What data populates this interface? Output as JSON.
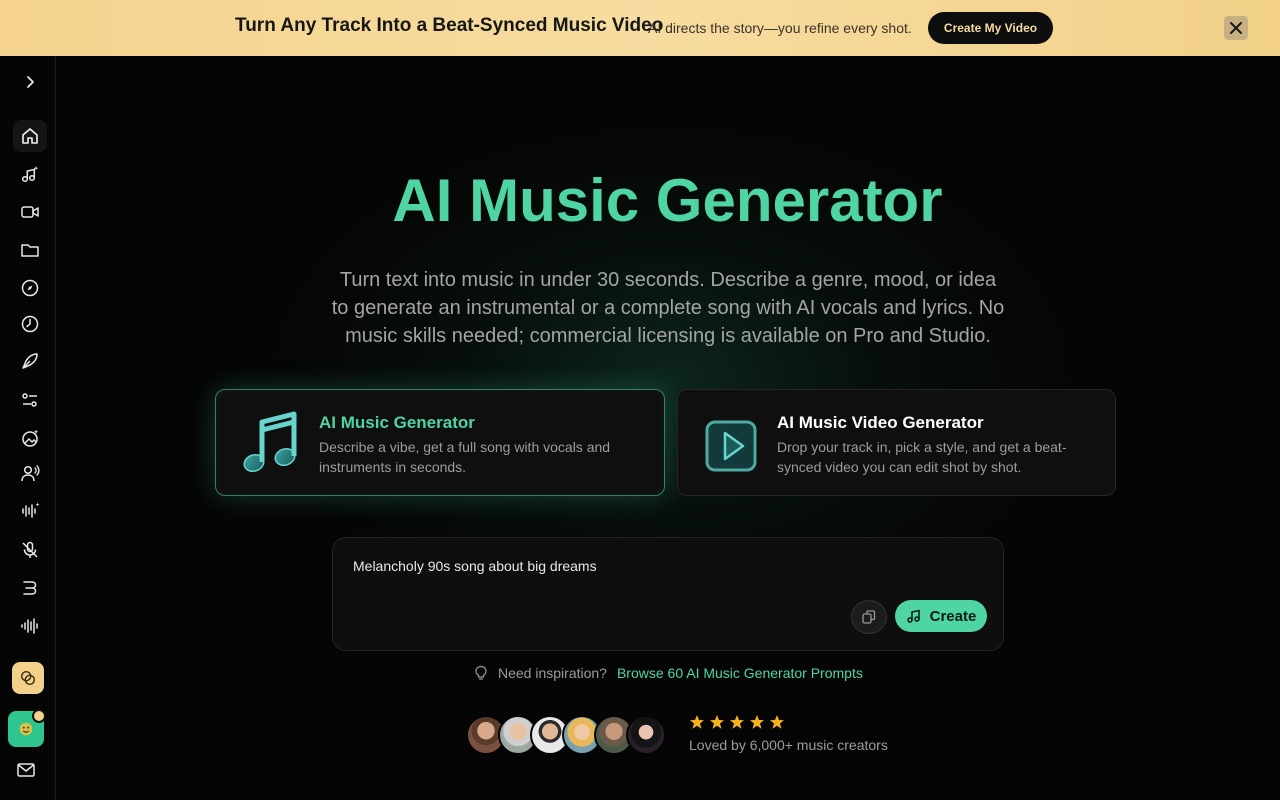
{
  "banner": {
    "title": "Turn Any Track Into a Beat-Synced Music Video",
    "subtitle": "AI directs the story—you refine every shot.",
    "cta": "Create My Video",
    "close_icon": "close-icon"
  },
  "sidebar": {
    "items": [
      {
        "name": "expand",
        "icon": "chevron-right-icon"
      },
      {
        "name": "home",
        "icon": "home-icon",
        "active": true
      },
      {
        "name": "music-generate",
        "icon": "music-sparkle-icon"
      },
      {
        "name": "video",
        "icon": "video-camera-icon"
      },
      {
        "name": "library",
        "icon": "folder-icon"
      },
      {
        "name": "explore",
        "icon": "compass-icon"
      },
      {
        "name": "history",
        "icon": "clock-icon"
      },
      {
        "name": "lyrics",
        "icon": "pen-icon"
      },
      {
        "name": "settings",
        "icon": "sliders-icon"
      },
      {
        "name": "image-gen",
        "icon": "image-sparkle-icon"
      },
      {
        "name": "voice",
        "icon": "person-voice-icon"
      },
      {
        "name": "audio-sparkle",
        "icon": "waveform-sparkle-icon"
      },
      {
        "name": "mute",
        "icon": "mic-off-icon"
      },
      {
        "name": "remix",
        "icon": "remix-icon"
      },
      {
        "name": "waveform",
        "icon": "waveform-icon"
      }
    ],
    "bottom": [
      "coin-icon",
      "user-avatar",
      "mail-icon"
    ]
  },
  "hero": {
    "title": "AI Music Generator",
    "description": "Turn text into music in under 30 seconds. Describe a genre, mood, or idea to generate an instrumental or a complete song with AI vocals and lyrics. No music skills needed; commercial licensing is available on Pro and Studio."
  },
  "cards": [
    {
      "title": "AI Music Generator",
      "description": "Describe a vibe, get a full song with vocals and instruments in seconds.",
      "icon": "music-note-icon",
      "active": true
    },
    {
      "title": "AI Music Video Generator",
      "description": "Drop your track in, pick a style, and get a beat-synced video you can edit shot by shot.",
      "icon": "play-video-icon",
      "active": false
    }
  ],
  "prompt": {
    "value": "Melancholy 90s song about big dreams",
    "create_label": "Create"
  },
  "inspiration": {
    "question": "Need inspiration?",
    "link": "Browse 60 AI Music Generator Prompts"
  },
  "social_proof": {
    "rating": 5,
    "text": "Loved by 6,000+ music creators",
    "avatar_count": 6
  },
  "colors": {
    "accent": "#4fd5a2",
    "banner_bg": "#f5d38e",
    "background": "#050505"
  }
}
